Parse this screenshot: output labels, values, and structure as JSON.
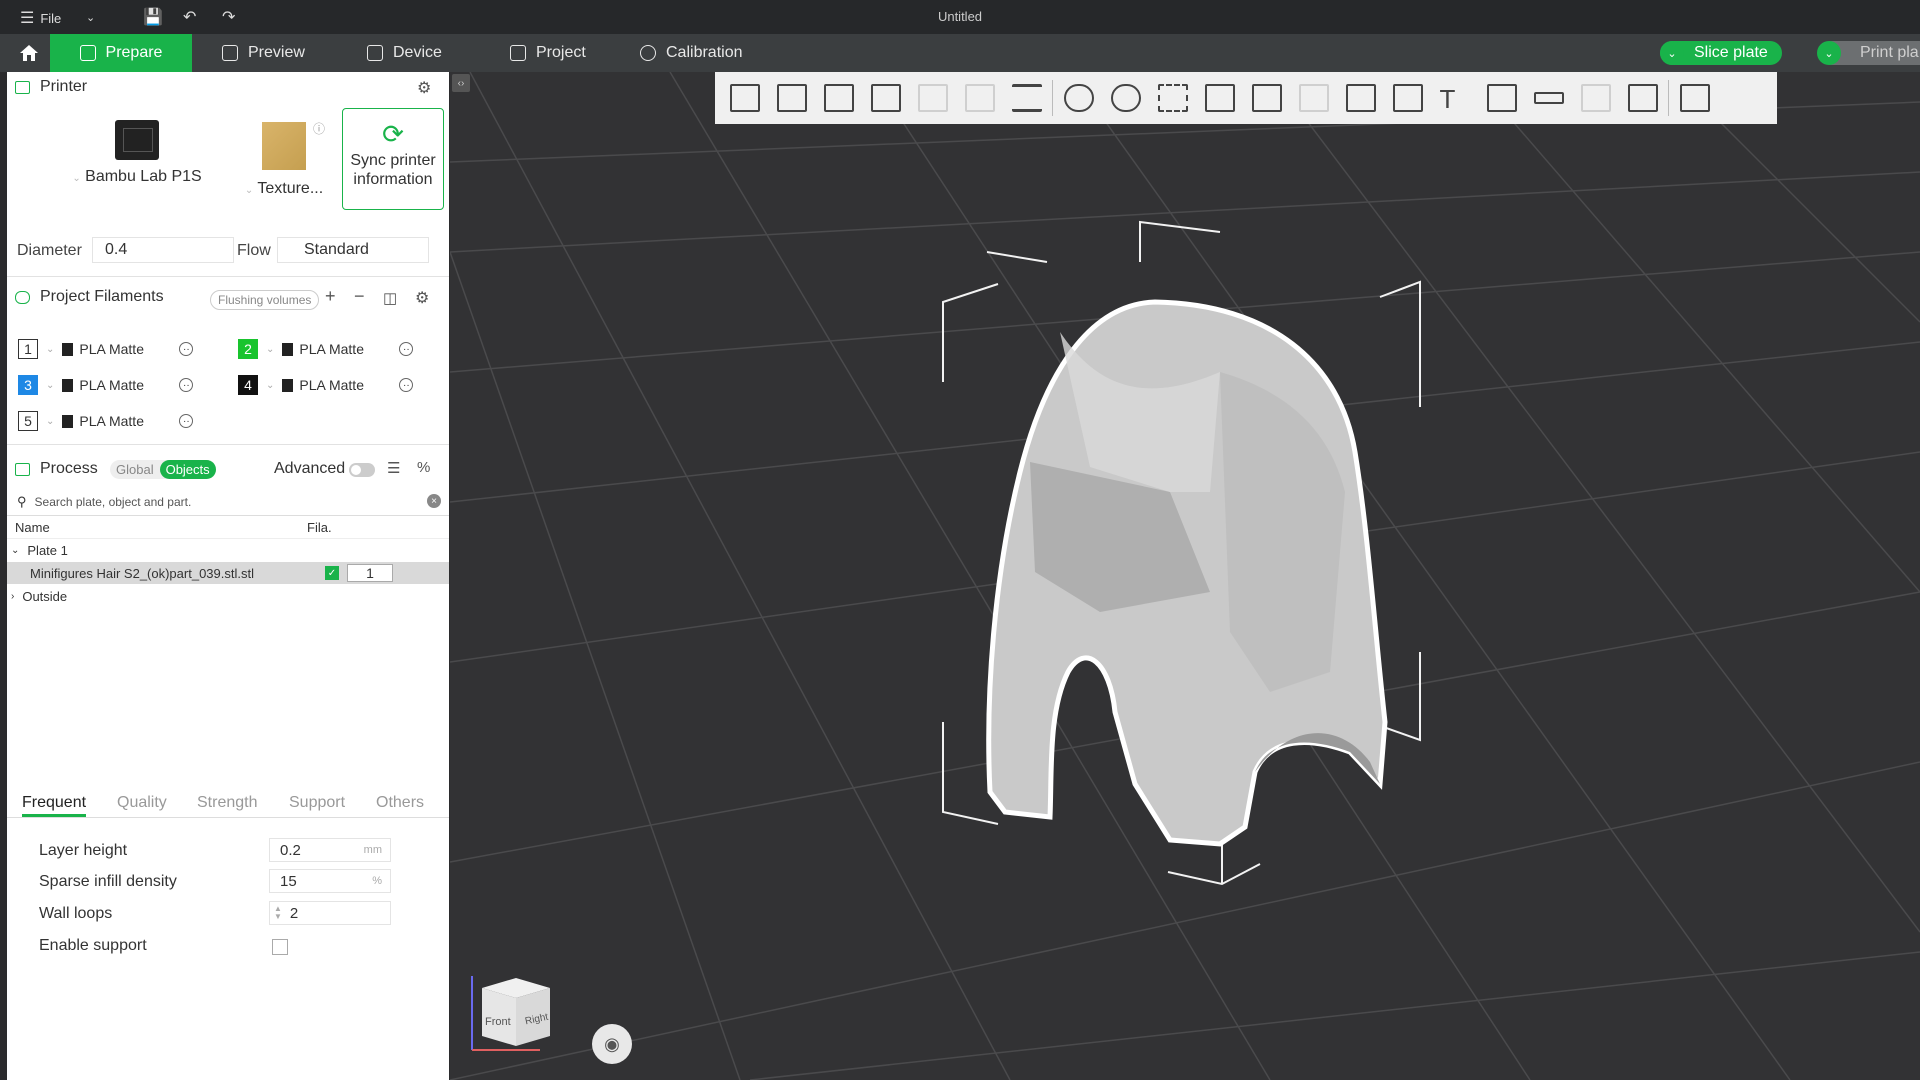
{
  "window": {
    "menu": "File",
    "title": "Untitled"
  },
  "nav": {
    "tabs": [
      "Prepare",
      "Preview",
      "Device",
      "Project",
      "Calibration"
    ],
    "slice_label": "Slice plate",
    "print_label": "Print pla"
  },
  "printer": {
    "section_title": "Printer",
    "printer_name": "Bambu Lab P1S",
    "plate_name": "Texture...",
    "sync_label_line1": "Sync printer",
    "sync_label_line2": "information",
    "diameter_label": "Diameter",
    "diameter_value": "0.4",
    "flow_label": "Flow",
    "flow_value": "Standard"
  },
  "filaments": {
    "section_title": "Project Filaments",
    "flushing_label": "Flushing volumes",
    "items": [
      {
        "num": "1",
        "name": "PLA Matte",
        "color": "#ffffff",
        "text_color": "#333333"
      },
      {
        "num": "2",
        "name": "PLA Matte",
        "color": "#19c42e",
        "text_color": "#ffffff"
      },
      {
        "num": "3",
        "name": "PLA Matte",
        "color": "#1e88e5",
        "text_color": "#ffffff"
      },
      {
        "num": "4",
        "name": "PLA Matte",
        "color": "#111111",
        "text_color": "#ffffff"
      },
      {
        "num": "5",
        "name": "PLA Matte",
        "color": "#ffffff",
        "text_color": "#333333"
      }
    ]
  },
  "process": {
    "section_title": "Process",
    "global_label": "Global",
    "objects_label": "Objects",
    "advanced_label": "Advanced",
    "search_placeholder": "Search plate, object and part.",
    "col_name": "Name",
    "col_fila": "Fila.",
    "plate_label": "Plate 1",
    "object_name": "Minifigures Hair S2_(ok)part_039.stl.stl",
    "object_fila": "1",
    "outside_label": "Outside"
  },
  "tabs": [
    "Frequent",
    "Quality",
    "Strength",
    "Support",
    "Others"
  ],
  "settings": {
    "layer_height_label": "Layer height",
    "layer_height_value": "0.2",
    "layer_height_unit": "mm",
    "infill_label": "Sparse infill density",
    "infill_value": "15",
    "infill_unit": "%",
    "walls_label": "Wall loops",
    "walls_value": "2",
    "support_label": "Enable support"
  },
  "viewport": {
    "cube_front": "Front",
    "cube_right": "Right"
  },
  "colors": {
    "accent": "#19b34a",
    "viewport_bg": "#323234",
    "nav_bg": "#3b3e40"
  }
}
